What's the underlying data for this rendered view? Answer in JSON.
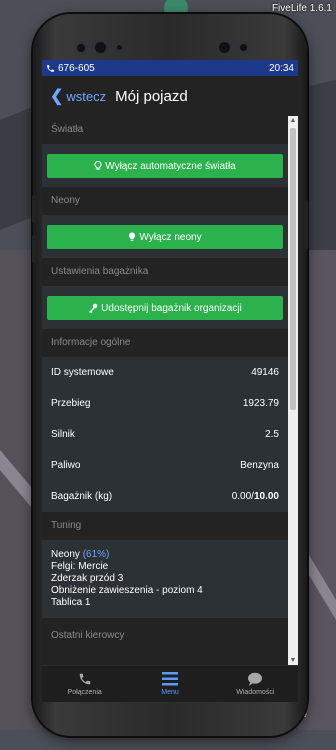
{
  "game": {
    "version": "FiveLife 1.6.1",
    "percent": "%"
  },
  "status_bar": {
    "phone_number": "676-605",
    "time": "20:34"
  },
  "header": {
    "back_label": "wstecz",
    "title": "Mój pojazd"
  },
  "sections": {
    "lights": {
      "title": "Światła",
      "button": "Wyłącz automatyczne światła",
      "icon": "lightbulb-icon"
    },
    "neons": {
      "title": "Neony",
      "button": "Wyłącz neony",
      "icon": "lightbulb-icon"
    },
    "trunk": {
      "title": "Ustawienia bagażnika",
      "button": "Udostępnij bagażnik organizacji",
      "icon": "key-icon"
    },
    "info": {
      "title": "Informacje ogólne",
      "rows": [
        {
          "label": "ID systemowe",
          "value": "49146"
        },
        {
          "label": "Przebieg",
          "value": "1923.79"
        },
        {
          "label": "Silnik",
          "value": "2.5"
        },
        {
          "label": "Paliwo",
          "value": "Benzyna"
        }
      ],
      "trunk_row": {
        "label": "Bagażnik (kg)",
        "value": "0.00/",
        "max": "10.00"
      }
    },
    "tuning": {
      "title": "Tuning",
      "neon_label": "Neony",
      "neon_pct": "(61%)",
      "lines": [
        "Felgi: Mercie",
        "Zderzak przód 3",
        "Obniżenie zawieszenia - poziom 4",
        "Tablica 1"
      ]
    },
    "last_drivers": {
      "title": "Ostatni kierowcy"
    }
  },
  "bottom_nav": [
    {
      "label": "Połączenia",
      "icon": "phone-icon",
      "active": false
    },
    {
      "label": "Menu",
      "icon": "menu-icon",
      "active": true
    },
    {
      "label": "Wiadomości",
      "icon": "chat-icon",
      "active": false
    }
  ],
  "colors": {
    "accent": "#2bb24c",
    "link": "#6aa7ff",
    "status_bar": "#1d3a8a",
    "panel": "#2c3135"
  }
}
